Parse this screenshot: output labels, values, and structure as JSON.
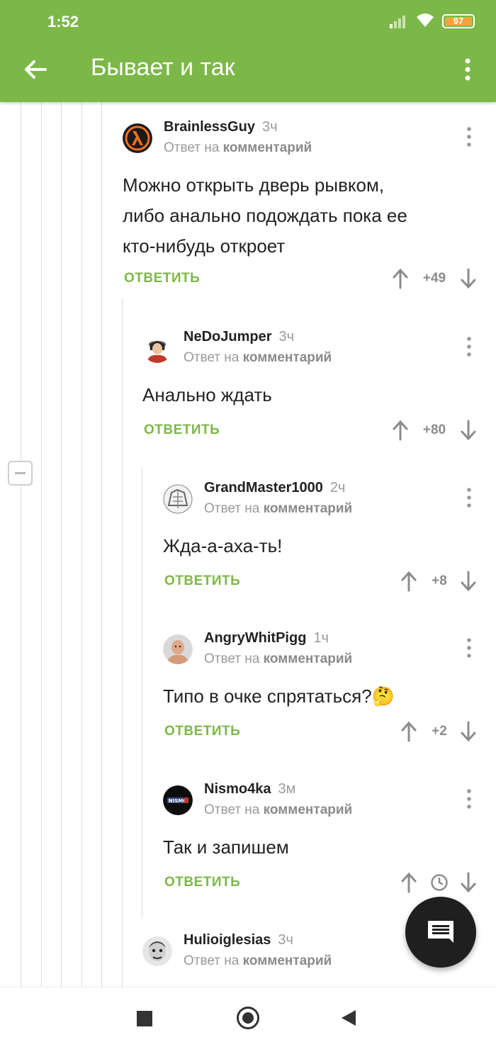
{
  "status": {
    "time": "1:52",
    "battery": "97"
  },
  "appbar": {
    "title": "Бывает и так",
    "back_icon": "arrow-left-icon",
    "more_icon": "more-vertical-icon"
  },
  "colors": {
    "brand": "#7cb848",
    "text": "#222222",
    "muted": "#9a9a9a",
    "fab": "#1f1f1f"
  },
  "comments": [
    {
      "author": "BrainlessGuy",
      "age": "3ч",
      "reply_prefix": "Ответ на",
      "reply_link": "комментарий",
      "lines": [
        "Можно открыть дверь рывком,",
        "либо анально подождать пока ее",
        "кто-нибудь откроет"
      ],
      "reply_label": "ОТВЕТИТЬ",
      "score": "+49"
    },
    {
      "author": "NeDoJumper",
      "age": "3ч",
      "reply_prefix": "Ответ на",
      "reply_link": "комментарий",
      "lines": [
        "Анально ждать"
      ],
      "reply_label": "ОТВЕТИТЬ",
      "score": "+80"
    },
    {
      "author": "GrandMaster1000",
      "age": "2ч",
      "reply_prefix": "Ответ на",
      "reply_link": "комментарий",
      "lines": [
        "Жда-а-аха-ть!"
      ],
      "reply_label": "ОТВЕТИТЬ",
      "score": "+8"
    },
    {
      "author": "AngryWhitPigg",
      "age": "1ч",
      "reply_prefix": "Ответ на",
      "reply_link": "комментарий",
      "lines": [
        "Типо в очке спрятаться?🤔"
      ],
      "reply_label": "ОТВЕТИТЬ",
      "score": "+2"
    },
    {
      "author": "Nismo4ka",
      "age": "3м",
      "reply_prefix": "Ответ на",
      "reply_link": "комментарий",
      "lines": [
        "Так и запишем"
      ],
      "reply_label": "ОТВЕТИТЬ",
      "score_icon": "clock-icon"
    },
    {
      "author": "Hulioiglesias",
      "age": "3ч",
      "reply_prefix": "Ответ на",
      "reply_link": "комментарий"
    }
  ],
  "fab_icon": "comment-icon",
  "nav": {
    "recents_icon": "square-icon",
    "home_icon": "circle-icon",
    "back_icon": "triangle-back-icon"
  }
}
